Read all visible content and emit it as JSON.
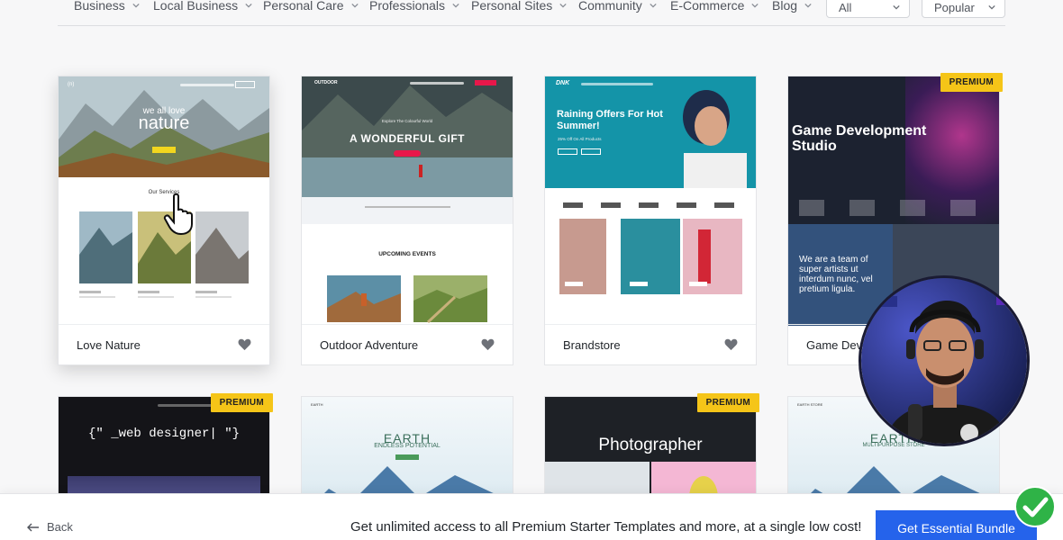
{
  "filters": {
    "categories": [
      {
        "label": "Business"
      },
      {
        "label": "Local Business"
      },
      {
        "label": "Personal Care"
      },
      {
        "label": "Professionals"
      },
      {
        "label": "Personal Sites"
      },
      {
        "label": "Community"
      },
      {
        "label": "E-Commerce"
      },
      {
        "label": "Blog"
      }
    ],
    "type_select": "All",
    "sort_select": "Popular"
  },
  "templates": [
    {
      "name": "Love Nature",
      "premium": false,
      "hero_top": "we all love",
      "hero_big": "nature",
      "section": "Our Services"
    },
    {
      "name": "Outdoor Adventure",
      "premium": false,
      "hero": "A WONDERFUL GIFT",
      "tagline": "Explore The Colourful World",
      "section": "UPCOMING EVENTS",
      "logo": "OUTDOOR"
    },
    {
      "name": "Brandstore",
      "premium": false,
      "hero": "Raining Offers For Hot Summer!",
      "sub": "25% Off On All Products",
      "logo": "DNK"
    },
    {
      "name": "Game Development Studio",
      "premium": true,
      "hero": "Game Development Studio",
      "body": "We are a team of super artists ut interdum nunc, vel pretium ligula."
    },
    {
      "name": "",
      "premium": true,
      "hero": "{\" _web designer| \"}"
    },
    {
      "name": "",
      "premium": false,
      "hero": "EARTH",
      "sub": "ENDLESS POTENTIAL",
      "logo": "EARTH"
    },
    {
      "name": "",
      "premium": true,
      "hero": "Photographer"
    },
    {
      "name": "",
      "premium": false,
      "hero": "EARTH",
      "sub": "MULTIPURPOSE STORE",
      "logo": "EARTH STORE"
    }
  ],
  "premium_label": "PREMIUM",
  "bottom": {
    "back_label": "Back",
    "promo": "Get unlimited access to all Premium Starter Templates and more, at a single low cost!",
    "cta": "Get Essential Bundle"
  },
  "colors": {
    "accent": "#2563eb",
    "premium_badge": "#f5c518"
  }
}
